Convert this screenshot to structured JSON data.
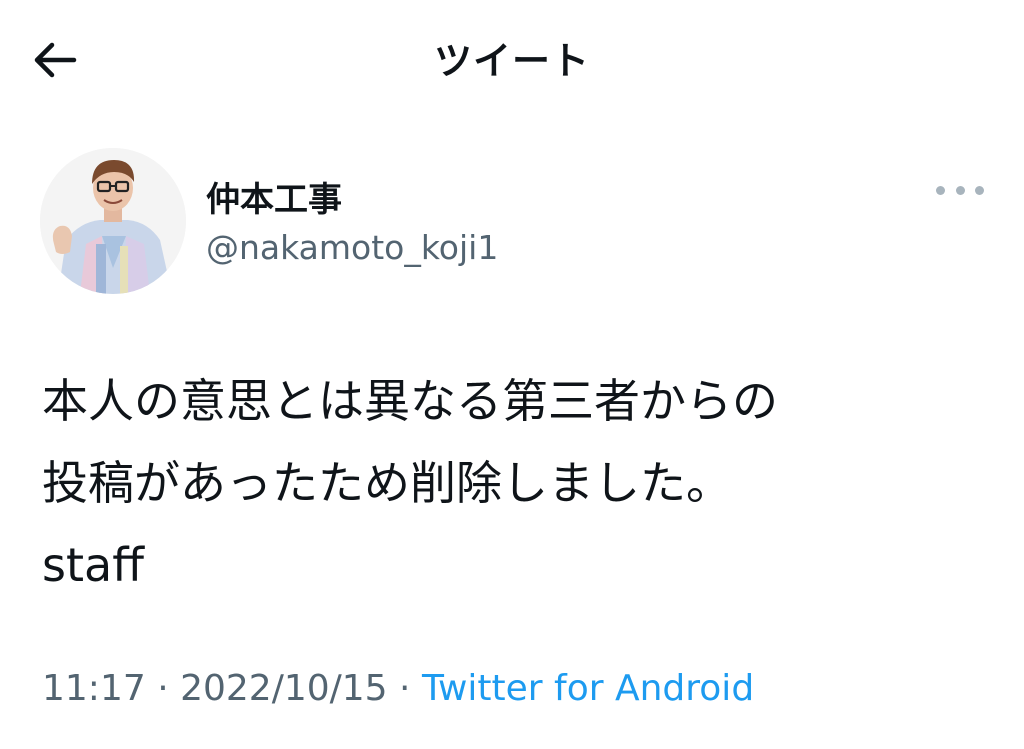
{
  "header": {
    "title": "ツイート",
    "back_icon": "arrow-left-icon"
  },
  "author": {
    "display_name": "仲本工事",
    "handle": "@nakamoto_koji1",
    "more_icon": "more-horizontal-icon"
  },
  "tweet": {
    "lines": [
      "本人の意思とは異なる第三者からの",
      "投稿があったため削除しました。",
      "staff"
    ]
  },
  "meta": {
    "time": "11:17",
    "separator_1": " · ",
    "date": "2022/10/15",
    "separator_2": " · ",
    "source": "Twitter for Android"
  },
  "colors": {
    "text_primary": "#0f1419",
    "text_secondary": "#536471",
    "link": "#1d9bf0"
  }
}
